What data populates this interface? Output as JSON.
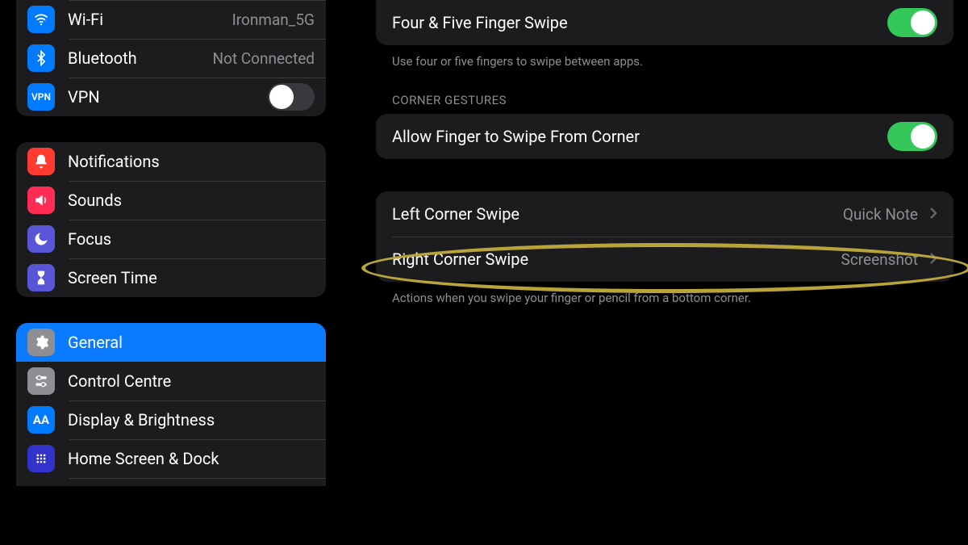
{
  "sidebar": {
    "group1": [
      {
        "name": "wifi",
        "label": "Wi-Fi",
        "value": "Ironman_5G"
      },
      {
        "name": "bluetooth",
        "label": "Bluetooth",
        "value": "Not Connected"
      },
      {
        "name": "vpn",
        "label": "VPN",
        "toggle": "off"
      }
    ],
    "group2": [
      {
        "name": "notifications",
        "label": "Notifications"
      },
      {
        "name": "sounds",
        "label": "Sounds"
      },
      {
        "name": "focus",
        "label": "Focus"
      },
      {
        "name": "screentime",
        "label": "Screen Time"
      }
    ],
    "group3": [
      {
        "name": "general",
        "label": "General",
        "selected": true
      },
      {
        "name": "controlcentre",
        "label": "Control Centre"
      },
      {
        "name": "display",
        "label": "Display & Brightness"
      },
      {
        "name": "homescreen",
        "label": "Home Screen & Dock"
      }
    ]
  },
  "detail": {
    "multitouch": {
      "label": "Four & Five Finger Swipe",
      "footer": "Use four or five fingers to swipe between apps."
    },
    "cornerHeader": "CORNER GESTURES",
    "allowCorner": {
      "label": "Allow Finger to Swipe From Corner"
    },
    "corners": [
      {
        "name": "left-corner-swipe",
        "label": "Left Corner Swipe",
        "value": "Quick Note"
      },
      {
        "name": "right-corner-swipe",
        "label": "Right Corner Swipe",
        "value": "Screenshot"
      }
    ],
    "cornerFooter": "Actions when you swipe your finger or pencil from a bottom corner."
  }
}
